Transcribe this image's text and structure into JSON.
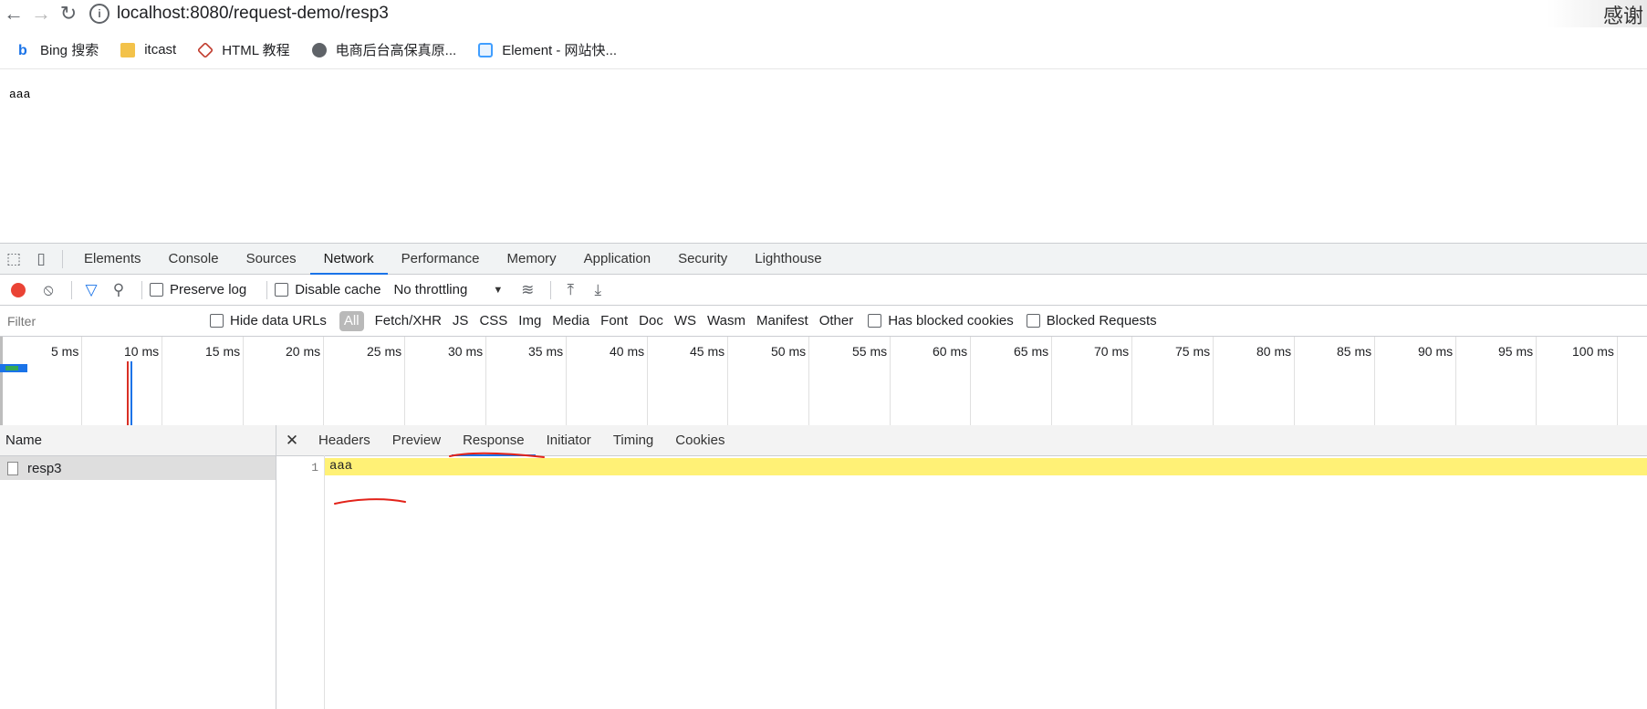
{
  "browser": {
    "url": "localhost:8080/request-demo/resp3",
    "watermark_text": "感谢"
  },
  "bookmarks": [
    {
      "label": "Bing 搜索",
      "icon": "bing-icon"
    },
    {
      "label": "itcast",
      "icon": "folder-icon"
    },
    {
      "label": "HTML 教程",
      "icon": "html-icon"
    },
    {
      "label": "电商后台高保真原...",
      "icon": "globe-icon"
    },
    {
      "label": "Element - 网站快...",
      "icon": "element-icon"
    }
  ],
  "page": {
    "body_text": "aaa"
  },
  "devtools": {
    "tabs": [
      "Elements",
      "Console",
      "Sources",
      "Network",
      "Performance",
      "Memory",
      "Application",
      "Security",
      "Lighthouse"
    ],
    "active_tab": "Network",
    "toolbar": {
      "preserve_log": "Preserve log",
      "disable_cache": "Disable cache",
      "throttling": "No throttling"
    },
    "filter": {
      "placeholder": "Filter",
      "hide_data_urls": "Hide data URLs",
      "types": [
        "All",
        "Fetch/XHR",
        "JS",
        "CSS",
        "Img",
        "Media",
        "Font",
        "Doc",
        "WS",
        "Wasm",
        "Manifest",
        "Other"
      ],
      "has_blocked_cookies": "Has blocked cookies",
      "blocked_requests": "Blocked Requests"
    },
    "timeline_ticks": [
      "5 ms",
      "10 ms",
      "15 ms",
      "20 ms",
      "25 ms",
      "30 ms",
      "35 ms",
      "40 ms",
      "45 ms",
      "50 ms",
      "55 ms",
      "60 ms",
      "65 ms",
      "70 ms",
      "75 ms",
      "80 ms",
      "85 ms",
      "90 ms",
      "95 ms",
      "100 ms"
    ],
    "requests": {
      "header": "Name",
      "rows": [
        "resp3"
      ]
    },
    "detail_tabs": [
      "Headers",
      "Preview",
      "Response",
      "Initiator",
      "Timing",
      "Cookies"
    ],
    "active_detail_tab": "Response",
    "response": {
      "line_number": "1",
      "content": "aaa"
    }
  },
  "colors": {
    "accent": "#1a73e8",
    "record": "#ea4335",
    "highlight": "#fff176",
    "annotation": "#e2231a"
  }
}
